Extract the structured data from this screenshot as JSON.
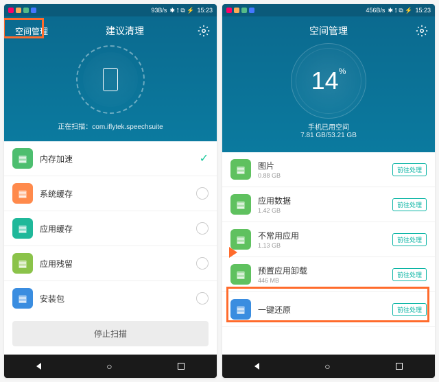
{
  "status": {
    "speed1": "93B/s",
    "speed2": "456B/s",
    "time": "15:23"
  },
  "left": {
    "tab": "空间管理",
    "title": "建议清理",
    "scan_prefix": "正在扫描：",
    "scan_pkg": "com.iflytek.speechsuite",
    "items": [
      {
        "label": "内存加速",
        "color": "#4dbe6f",
        "checked": true
      },
      {
        "label": "系统缓存",
        "color": "#ff8a4c"
      },
      {
        "label": "应用缓存",
        "color": "#1fb89a"
      },
      {
        "label": "应用残留",
        "color": "#8bc34a"
      },
      {
        "label": "安装包",
        "color": "#3a8de0"
      }
    ],
    "stop": "停止扫描"
  },
  "right": {
    "title": "空间管理",
    "percent": "14",
    "unit": "%",
    "used_label": "手机已用空间",
    "used": "7.81 GB/53.21 GB",
    "items": [
      {
        "label": "图片",
        "sub": "0.88 GB"
      },
      {
        "label": "应用数据",
        "sub": "1.42 GB"
      },
      {
        "label": "不常用应用",
        "sub": "1.13 GB"
      },
      {
        "label": "预置应用卸载",
        "sub": "446 MB"
      },
      {
        "label": "一键还原",
        "sub": ""
      }
    ],
    "action": "前往处理"
  }
}
